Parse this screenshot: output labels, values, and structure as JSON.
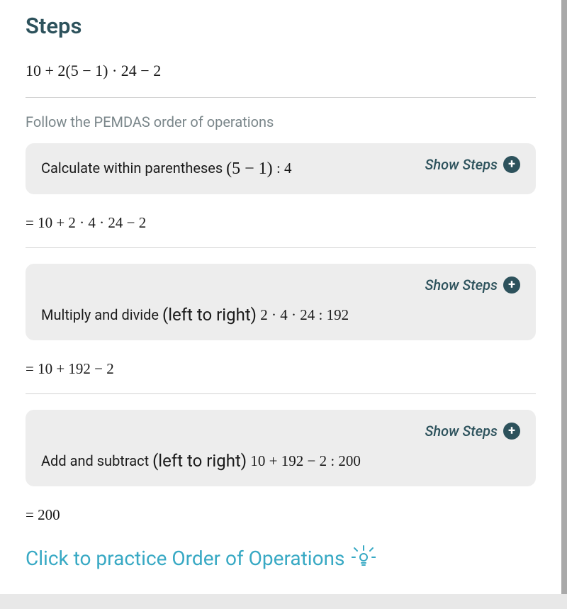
{
  "title": "Steps",
  "original_expression": "10 + 2(5 − 1) ·  24 − 2",
  "instruction": "Follow the PEMDAS order of operations",
  "show_steps_label": "Show Steps",
  "steps": [
    {
      "label_prefix": "Calculate within parentheses ",
      "paren_expr": "(5 − 1)",
      "colon_result": " :   4",
      "result_line": "= 10 + 2 ·  4 ·  24 − 2",
      "inline_layout": true
    },
    {
      "label_prefix": "Multiply and divide ",
      "paren_text": "(left to right)",
      "expr_after": " 2 ·  4 ·  24 :   192",
      "result_line": "= 10 + 192 − 2",
      "inline_layout": false
    },
    {
      "label_prefix": "Add and subtract ",
      "paren_text": "(left to right)",
      "expr_after": " 10 + 192 − 2 :   200",
      "result_line": "= 200",
      "inline_layout": false
    }
  ],
  "practice_link": "Click to practice Order of Operations"
}
